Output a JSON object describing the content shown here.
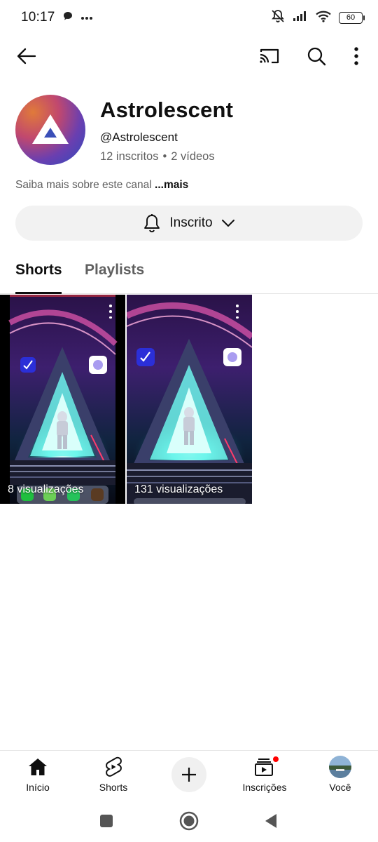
{
  "status_bar": {
    "time": "10:17",
    "battery": "60"
  },
  "app_bar": {
    "back_icon": "arrow-left-icon",
    "cast_icon": "cast-icon",
    "search_icon": "search-icon",
    "more_icon": "more-vertical-icon"
  },
  "channel": {
    "name": "Astrolescent",
    "handle": "@Astrolescent",
    "subscribers": "12 inscritos",
    "separator": "•",
    "videos": "2 vídeos",
    "about": "Saiba mais sobre este canal",
    "about_more": "...mais",
    "subscribe_label": "Inscrito"
  },
  "tabs": [
    {
      "label": "Shorts",
      "active": true
    },
    {
      "label": "Playlists",
      "active": false
    }
  ],
  "shorts": [
    {
      "views": "8 visualizações"
    },
    {
      "views": "131 visualizações"
    }
  ],
  "bottom_nav": [
    {
      "label": "Início",
      "icon": "home-icon"
    },
    {
      "label": "Shorts",
      "icon": "shorts-icon"
    },
    {
      "label": "",
      "icon": "plus-icon"
    },
    {
      "label": "Inscrições",
      "icon": "subscriptions-icon"
    },
    {
      "label": "Você",
      "icon": "profile-avatar"
    }
  ],
  "colors": {
    "text_primary": "#0f0f0f",
    "text_secondary": "#606060",
    "button_bg": "#f2f2f2",
    "notification_dot": "#ff0000"
  }
}
